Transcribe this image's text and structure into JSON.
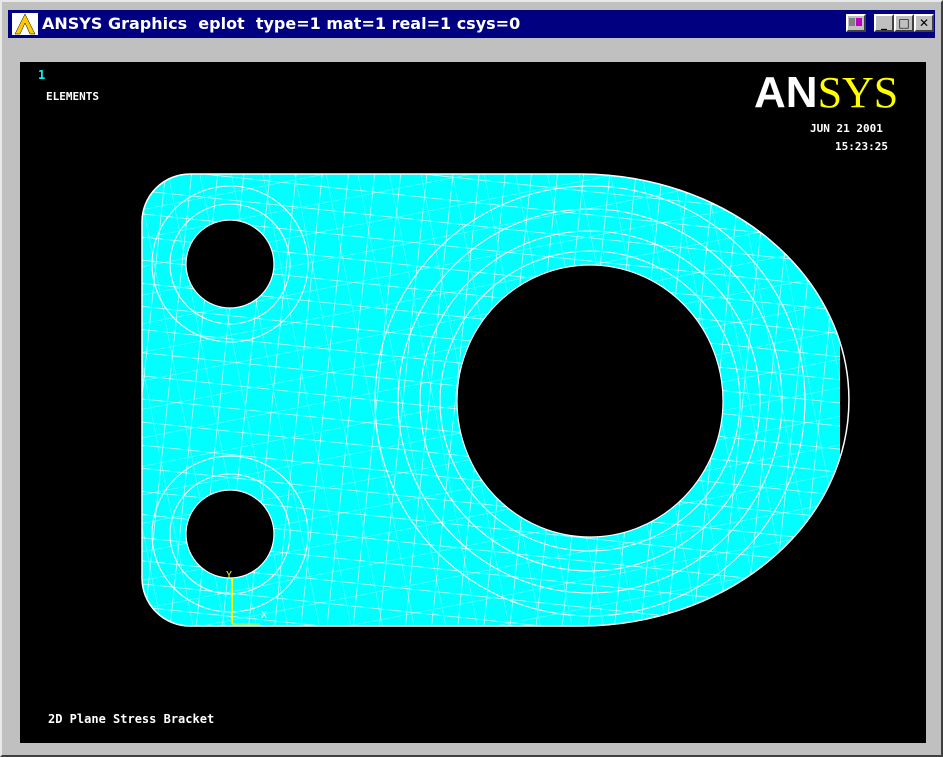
{
  "window": {
    "title": "ANSYS Graphics  eplot  type=1 mat=1 real=1 csys=0",
    "buttons": {
      "toggle": "",
      "minimize": "_",
      "maximize": "□",
      "close": "✕"
    }
  },
  "viewport": {
    "window_number": "1",
    "plot_type": "ELEMENTS",
    "brand": {
      "part1": "AN",
      "part2": "SYS"
    },
    "date": "JUN 21 2001",
    "time": "15:23:25",
    "plot_title": "2D Plane Stress Bracket",
    "triad": {
      "y_label": "Y",
      "x_label": "X"
    }
  },
  "colors": {
    "mesh_fill": "#00ffff",
    "mesh_lines": "#ffffff",
    "background": "#000000",
    "titlebar": "#000080",
    "brand_white": "#ffffff",
    "brand_yellow": "#ffff00",
    "triad": "#ffff00"
  }
}
